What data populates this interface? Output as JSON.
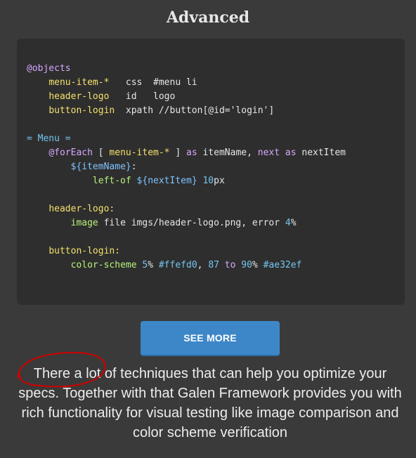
{
  "section": {
    "title": "Advanced"
  },
  "code": {
    "lines": [
      [
        {
          "t": "@objects",
          "c": "c-kw"
        }
      ],
      [
        {
          "t": "    "
        },
        {
          "t": "menu-item-*",
          "c": "c-obj"
        },
        {
          "t": "   css  #menu li",
          "c": "c-plain"
        }
      ],
      [
        {
          "t": "    "
        },
        {
          "t": "header-logo",
          "c": "c-obj"
        },
        {
          "t": "   id   logo",
          "c": "c-plain"
        }
      ],
      [
        {
          "t": "    "
        },
        {
          "t": "button-login",
          "c": "c-obj"
        },
        {
          "t": "  xpath //button[@id='login']",
          "c": "c-plain"
        }
      ],
      [
        {
          "t": ""
        }
      ],
      [
        {
          "t": "= Menu =",
          "c": "c-sec"
        }
      ],
      [
        {
          "t": "    "
        },
        {
          "t": "@forEach",
          "c": "c-kw"
        },
        {
          "t": " [ ",
          "c": "c-plain"
        },
        {
          "t": "menu-item-*",
          "c": "c-obj"
        },
        {
          "t": " ] ",
          "c": "c-plain"
        },
        {
          "t": "as",
          "c": "c-kw"
        },
        {
          "t": " itemName, ",
          "c": "c-plain"
        },
        {
          "t": "next",
          "c": "c-kw"
        },
        {
          "t": " ",
          "c": "c-plain"
        },
        {
          "t": "as",
          "c": "c-kw"
        },
        {
          "t": " nextItem",
          "c": "c-plain"
        }
      ],
      [
        {
          "t": "        "
        },
        {
          "t": "${itemName}",
          "c": "c-var"
        },
        {
          "t": ":",
          "c": "c-plain"
        }
      ],
      [
        {
          "t": "            "
        },
        {
          "t": "left-of",
          "c": "c-spec"
        },
        {
          "t": " ",
          "c": "c-plain"
        },
        {
          "t": "${nextItem}",
          "c": "c-var"
        },
        {
          "t": " ",
          "c": "c-plain"
        },
        {
          "t": "10",
          "c": "c-num"
        },
        {
          "t": "px",
          "c": "c-plain"
        }
      ],
      [
        {
          "t": ""
        }
      ],
      [
        {
          "t": "    "
        },
        {
          "t": "header-logo:",
          "c": "c-obj"
        }
      ],
      [
        {
          "t": "        "
        },
        {
          "t": "image",
          "c": "c-spec"
        },
        {
          "t": " file imgs/header-logo.png, error ",
          "c": "c-plain"
        },
        {
          "t": "4",
          "c": "c-num"
        },
        {
          "t": "%",
          "c": "c-plain"
        }
      ],
      [
        {
          "t": ""
        }
      ],
      [
        {
          "t": "    "
        },
        {
          "t": "button-login:",
          "c": "c-obj"
        }
      ],
      [
        {
          "t": "        "
        },
        {
          "t": "color-scheme",
          "c": "c-spec"
        },
        {
          "t": " ",
          "c": "c-plain"
        },
        {
          "t": "5",
          "c": "c-num"
        },
        {
          "t": "% ",
          "c": "c-plain"
        },
        {
          "t": "#ffefd0",
          "c": "c-color"
        },
        {
          "t": ", ",
          "c": "c-plain"
        },
        {
          "t": "87",
          "c": "c-num"
        },
        {
          "t": " ",
          "c": "c-plain"
        },
        {
          "t": "to",
          "c": "c-kw"
        },
        {
          "t": " ",
          "c": "c-plain"
        },
        {
          "t": "90",
          "c": "c-num"
        },
        {
          "t": "% ",
          "c": "c-plain"
        },
        {
          "t": "#ae32ef",
          "c": "c-color"
        }
      ]
    ]
  },
  "button": {
    "label": "SEE MORE"
  },
  "description": {
    "text": "There a lot of techniques that can help you optimize your specs. Together with that Galen Framework provides you with rich functionality for visual testing like image comparison and color scheme verification"
  },
  "colors": {
    "background": "#3a3a3a",
    "code_background": "#2e2e2e",
    "button": "#3d87c8",
    "annotation": "#d00000"
  }
}
